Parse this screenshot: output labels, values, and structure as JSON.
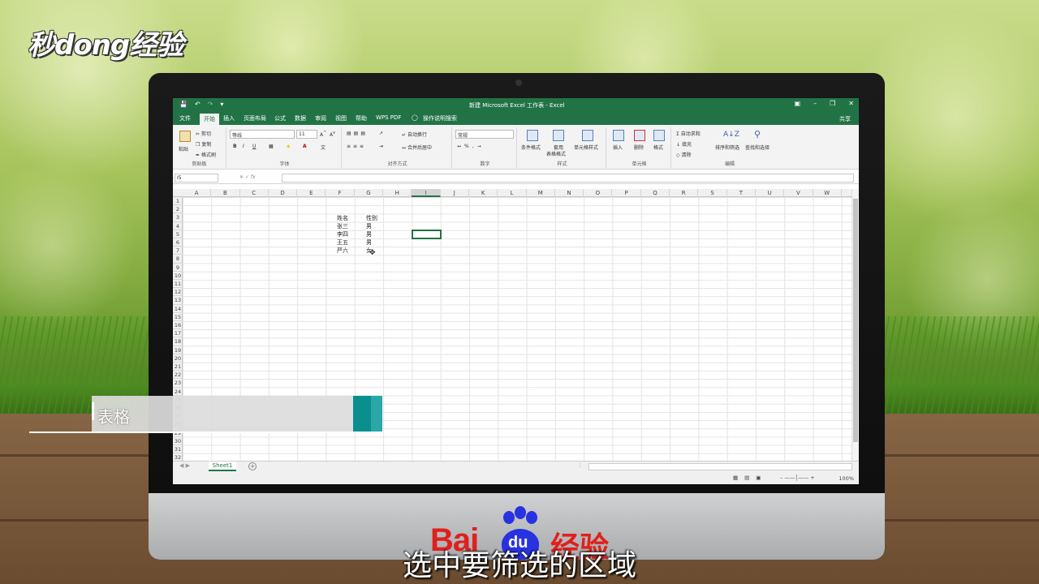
{
  "watermark_logo": "秒dong经验",
  "baidu_logo": {
    "bai": "Bai",
    "du": "du",
    "jingyan": "经验"
  },
  "excel": {
    "title": "新建 Microsoft Excel 工作表 - Excel",
    "menu_tabs": [
      "文件",
      "开始",
      "插入",
      "页面布局",
      "公式",
      "数据",
      "审阅",
      "视图",
      "帮助",
      "WPS PDF"
    ],
    "active_tab": "开始",
    "tell_me": "操作说明搜索",
    "share": "共享",
    "ribbon": {
      "clipboard": {
        "paste": "粘贴",
        "cut": "剪切",
        "copy": "复制",
        "format_painter": "格式刷",
        "label": "剪贴板"
      },
      "font": {
        "font_name": "等线",
        "font_size": "11",
        "label": "字体"
      },
      "alignment": {
        "wrap": "自动换行",
        "merge": "合并后居中",
        "label": "对齐方式"
      },
      "number": {
        "format": "常规",
        "label": "数字"
      },
      "styles": {
        "conditional": "条件格式",
        "table": "套用",
        "table2": "表格格式",
        "cell_styles": "单元格样式",
        "label": "样式"
      },
      "cells": {
        "insert": "插入",
        "delete": "删除",
        "format": "格式",
        "label": "单元格"
      },
      "editing": {
        "autosum": "自动求和",
        "fill": "填充",
        "clear": "清除",
        "sort_filter": "排序和筛选",
        "find_select": "查找和选择",
        "label": "编辑"
      }
    },
    "name_box": "I5",
    "columns": [
      "A",
      "B",
      "C",
      "D",
      "E",
      "F",
      "G",
      "H",
      "I",
      "J",
      "K",
      "L",
      "M",
      "N",
      "O",
      "P",
      "Q",
      "R",
      "S",
      "T",
      "U",
      "V",
      "W"
    ],
    "selected_column": "I",
    "rows": [
      "1",
      "2",
      "3",
      "4",
      "5",
      "6",
      "7",
      "8",
      "9",
      "10",
      "11",
      "12",
      "13",
      "14",
      "15",
      "16",
      "17",
      "18",
      "19",
      "20",
      "21",
      "22",
      "23",
      "24",
      "25",
      "26",
      "27",
      "28",
      "29",
      "30",
      "31",
      "32"
    ],
    "table": {
      "header": [
        "姓名",
        "性别"
      ],
      "rows": [
        [
          "张三",
          "男"
        ],
        [
          "李四",
          "男"
        ],
        [
          "王五",
          "男"
        ],
        [
          "严六",
          "女"
        ]
      ]
    },
    "sheet_tab": "Sheet1",
    "zoom": "100%"
  },
  "lower_third": "表格",
  "subtitle": "选中要筛选的区域"
}
